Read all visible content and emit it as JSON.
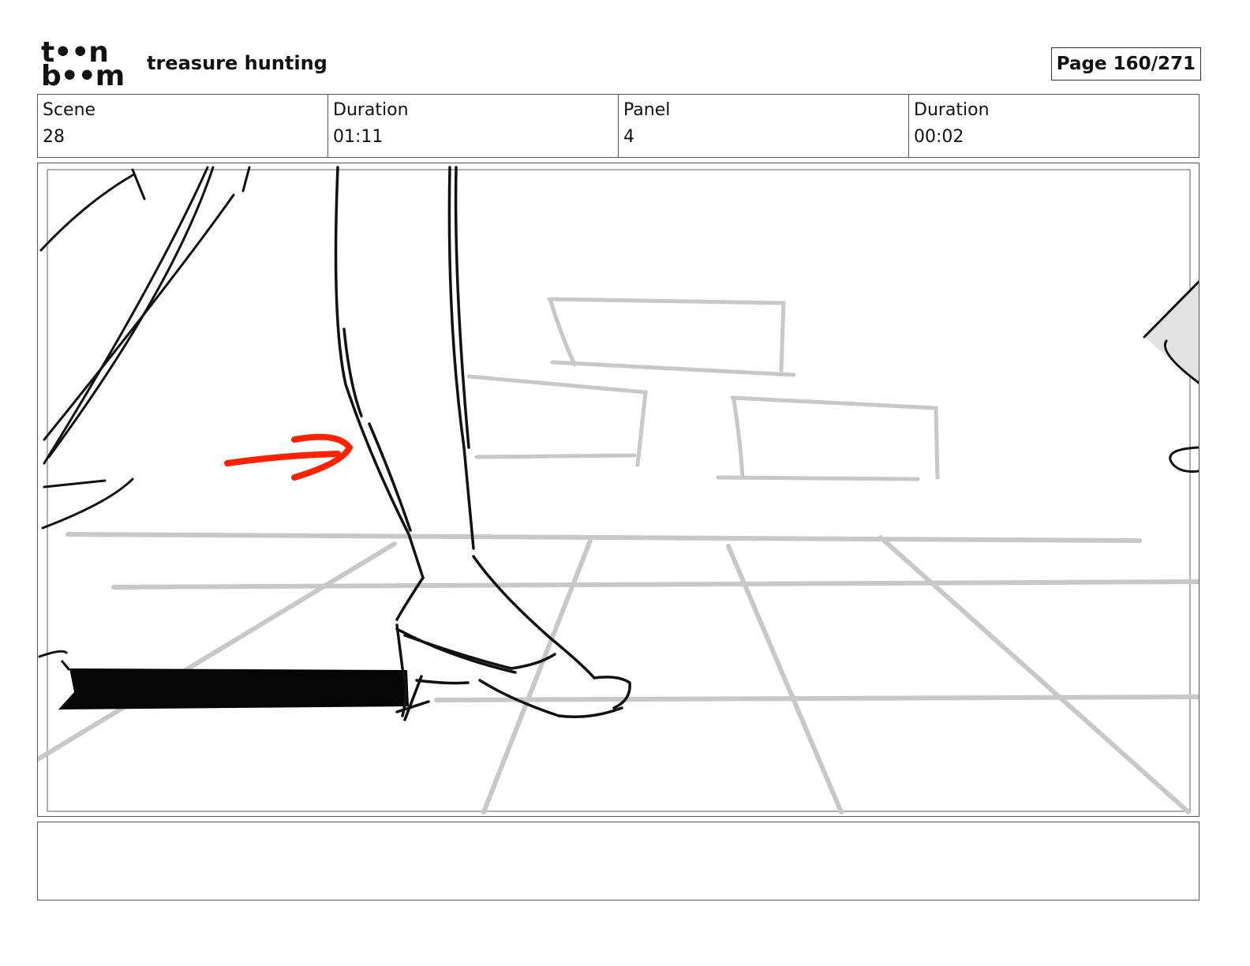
{
  "header": {
    "logo_line1": "t••n",
    "logo_line2": "b••m",
    "project_title": "treasure hunting",
    "page_label": "Page 160/271"
  },
  "info": {
    "scene_label": "Scene",
    "scene_value": "28",
    "scene_duration_label": "Duration",
    "scene_duration_value": "01:11",
    "panel_label": "Panel",
    "panel_value": "4",
    "panel_duration_label": "Duration",
    "panel_duration_value": "00:02"
  },
  "colors": {
    "arrow": "#ff2200",
    "sketch": "#111111",
    "background_lines": "#c8c8c8"
  },
  "notes": {
    "text": ""
  }
}
